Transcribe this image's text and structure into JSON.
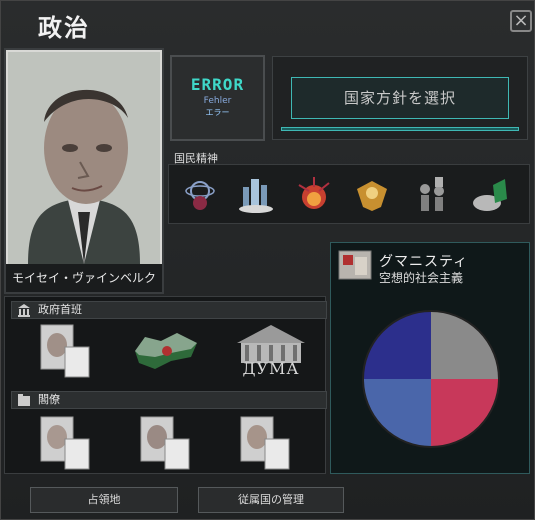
{
  "window": {
    "title": "政治"
  },
  "leader": {
    "name": "モイセイ・ヴァインベルク"
  },
  "ideology_badge": {
    "main": "ERROR",
    "sub": "Fehler",
    "sub2": "エラー"
  },
  "focus": {
    "button_label": "国家方針を選択"
  },
  "spirits": {
    "label": "国民精神",
    "items": [
      "atom-flower-icon",
      "city-icon",
      "explosion-icon",
      "eagle-emblem-icon",
      "fist-crowd-icon",
      "industry-icon"
    ]
  },
  "government": {
    "label": "政府首班",
    "duma_text": "ДУМА"
  },
  "cabinet": {
    "label": "閣僚"
  },
  "party": {
    "name": "グマニスティ",
    "ideology": "空想的社会主義"
  },
  "party_chart": {
    "type": "pie",
    "colors": [
      "#2c2f8c",
      "#8a8a8a",
      "#c8385a",
      "#4a66aa"
    ]
  },
  "bottom": {
    "occupied_label": "占領地",
    "subjects_label": "従属国の管理"
  }
}
